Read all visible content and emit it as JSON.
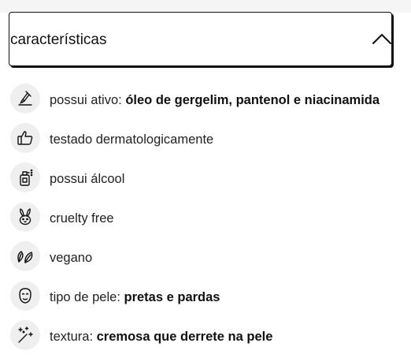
{
  "accordion": {
    "title": "características",
    "expanded": true,
    "toggle_icon": "chevron-up-icon"
  },
  "features": [
    {
      "icon": "dropper-icon",
      "label": "possui ativo:",
      "value": "óleo de gergelim, pantenol e niacinamida"
    },
    {
      "icon": "thumbs-up-icon",
      "label": "testado dermatologicamente",
      "value": ""
    },
    {
      "icon": "spray-bottle-icon",
      "label": "possui álcool",
      "value": ""
    },
    {
      "icon": "rabbit-icon",
      "label": "cruelty free",
      "value": ""
    },
    {
      "icon": "leaves-icon",
      "label": "vegano",
      "value": ""
    },
    {
      "icon": "face-icon",
      "label": "tipo de pele:",
      "value": "pretas e pardas"
    },
    {
      "icon": "magic-wand-icon",
      "label": "textura:",
      "value": "cremosa que derrete na pele"
    }
  ]
}
